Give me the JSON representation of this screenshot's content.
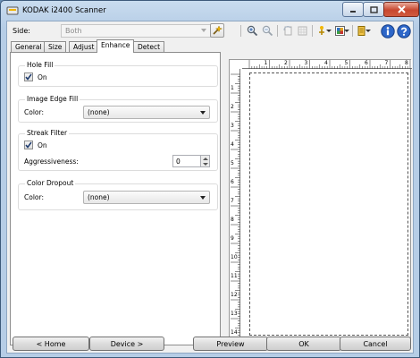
{
  "window": {
    "title": "KODAK i2400 Scanner",
    "title_bar_buttons": [
      "minimize",
      "maximize",
      "close"
    ]
  },
  "toolbar": {
    "side_label": "Side:",
    "side_value": "Both",
    "icons": [
      "wizard-icon",
      "zoom-in-icon",
      "zoom-out-icon",
      "rotate-icon",
      "grid-icon",
      "image-settings-icon",
      "color-preview-icon",
      "settings-shortcut-icon",
      "info-icon",
      "help-icon"
    ]
  },
  "tabs": [
    "General",
    "Size",
    "Adjust",
    "Enhance",
    "Detect"
  ],
  "active_tab": "Enhance",
  "enhance": {
    "hole_fill": {
      "title": "Hole Fill",
      "on_label": "On",
      "checked": true
    },
    "image_edge_fill": {
      "title": "Image Edge Fill",
      "color_label": "Color:",
      "color_value": "(none)"
    },
    "streak_filter": {
      "title": "Streak Filter",
      "on_label": "On",
      "checked": true,
      "aggressiveness_label": "Aggressiveness:",
      "aggressiveness_value": "0"
    },
    "color_dropout": {
      "title": "Color Dropout",
      "color_label": "Color:",
      "color_value": "(none)"
    }
  },
  "ruler": {
    "top_numbers": [
      "1",
      "2",
      "3",
      "4",
      "5",
      "6",
      "7",
      "8"
    ],
    "left_numbers": [
      "1",
      "2",
      "3",
      "4",
      "5",
      "6",
      "7",
      "8",
      "9",
      "10",
      "11",
      "12",
      "13",
      "14"
    ]
  },
  "buttons": {
    "home": "< Home",
    "device": "Device >",
    "preview": "Preview",
    "ok": "OK",
    "cancel": "Cancel"
  }
}
